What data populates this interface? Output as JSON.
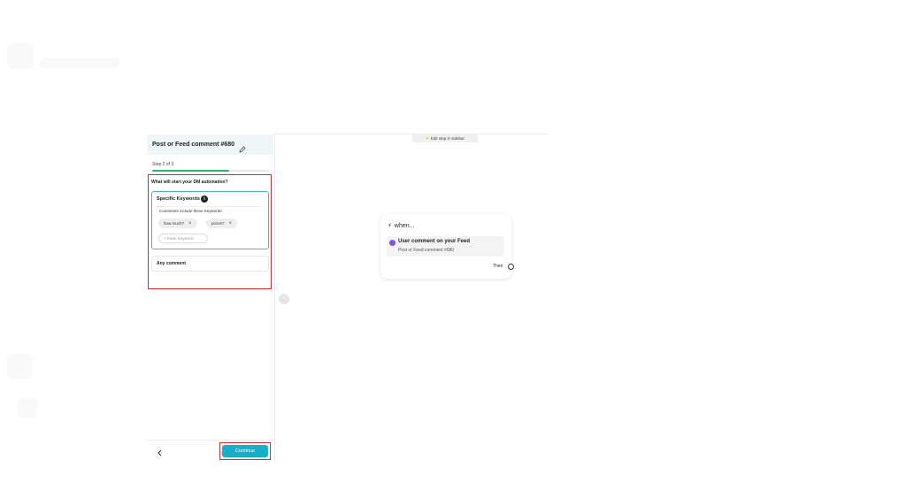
{
  "panel": {
    "title": "Post or Feed comment #680",
    "step_label": "Step 2 of 3",
    "progress": 0.66,
    "question": "What will start your DM automation?",
    "keywords": {
      "title": "Specific Keywords",
      "subtitle": "Comments include these Keywords:",
      "chips": [
        "how much?",
        "prices?"
      ],
      "input_placeholder": "+ Enter Keyword"
    },
    "any_comment_label": "Any comment",
    "continue_label": "Continue"
  },
  "canvas": {
    "edit_banner": "Edit step in sidebar",
    "node": {
      "when_label": "when...",
      "trigger_title": "User comment on your Feed",
      "trigger_subtitle": "Post or Feed comment #680",
      "then_label": "Then"
    }
  },
  "colors": {
    "accent": "#18aec5",
    "progress": "#22b573",
    "highlight": "#d62b2b",
    "keyword_border": "#4fb3bd"
  }
}
